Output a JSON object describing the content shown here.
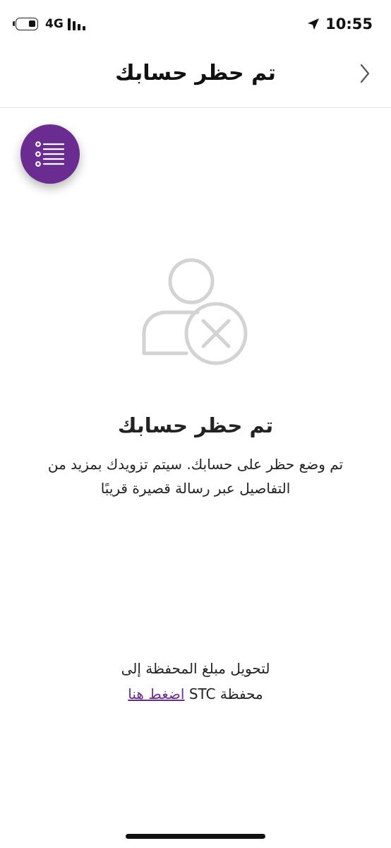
{
  "status_bar": {
    "network": "4G",
    "time": "10:55"
  },
  "header": {
    "title": "تم حظر حسابك"
  },
  "content": {
    "title": "تم حظر حسابك",
    "message_line1": "تم وضع حظر على حسابك. سيتم تزويدك بمزيد من",
    "message_line2": "التفاصيل عبر رسالة قصيرة قريبًا"
  },
  "transfer": {
    "line1": "لتحويل مبلغ المحفظة إلى",
    "line2_prefix": "محفظة STC",
    "link": "اضغط هنا"
  },
  "colors": {
    "brand_purple": "#6a2c91",
    "icon_gray": "#d3d3d6"
  }
}
